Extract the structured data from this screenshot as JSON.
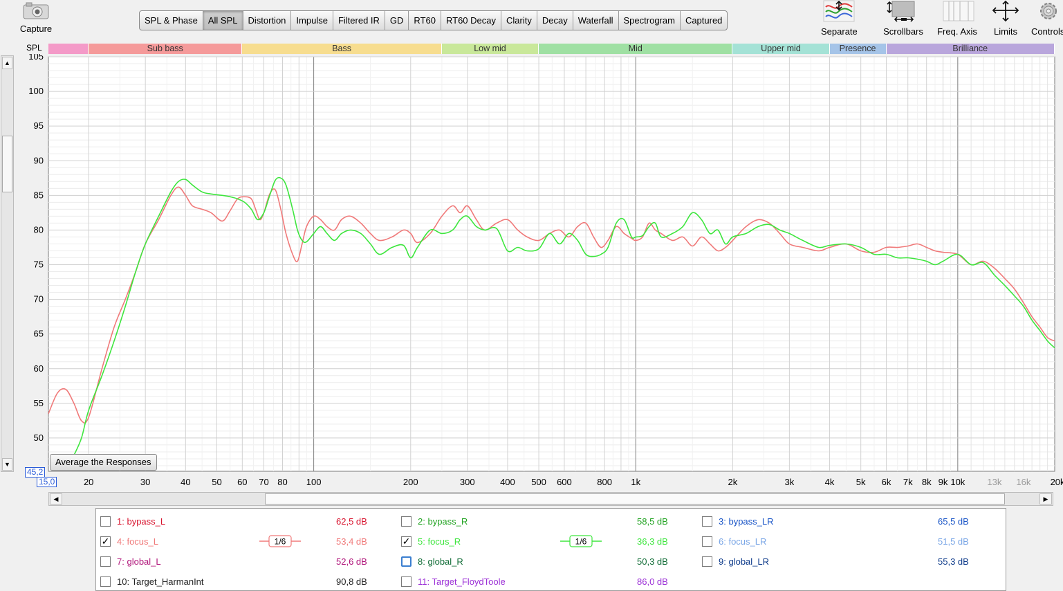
{
  "toolbar": {
    "capture_label": "Capture",
    "tabs": [
      {
        "label": "SPL & Phase",
        "active": false
      },
      {
        "label": "All SPL",
        "active": true
      },
      {
        "label": "Distortion",
        "active": false
      },
      {
        "label": "Impulse",
        "active": false
      },
      {
        "label": "Filtered IR",
        "active": false
      },
      {
        "label": "GD",
        "active": false
      },
      {
        "label": "RT60",
        "active": false
      },
      {
        "label": "RT60 Decay",
        "active": false
      },
      {
        "label": "Clarity",
        "active": false
      },
      {
        "label": "Decay",
        "active": false
      },
      {
        "label": "Waterfall",
        "active": false
      },
      {
        "label": "Spectrogram",
        "active": false
      },
      {
        "label": "Captured",
        "active": false
      }
    ],
    "right_tools": {
      "separate": "Separate",
      "scrollbars": "Scrollbars",
      "freq_axis": "Freq. Axis",
      "limits": "Limits",
      "controls": "Controls"
    }
  },
  "bands": [
    {
      "name": "",
      "color": "#f49ac8"
    },
    {
      "name": "Sub bass",
      "color": "#f59a9a"
    },
    {
      "name": "Bass",
      "color": "#f7dd8f"
    },
    {
      "name": "Low mid",
      "color": "#c9e89a"
    },
    {
      "name": "Mid",
      "color": "#9fe0a3"
    },
    {
      "name": "Upper mid",
      "color": "#a4e2d6"
    },
    {
      "name": "Presence",
      "color": "#a5c4e8"
    },
    {
      "name": "Brilliance",
      "color": "#b9a6dc"
    }
  ],
  "chart_data": {
    "type": "line",
    "ylabel": "SPL",
    "ylim": [
      45.2,
      105
    ],
    "y_ticks": [
      "105",
      "100",
      "95",
      "90",
      "85",
      "80",
      "75",
      "70",
      "65",
      "60",
      "55",
      "50"
    ],
    "xlim": [
      15,
      20000
    ],
    "x_scale": "log",
    "x_ticks": [
      "20",
      "30",
      "40",
      "50",
      "60",
      "70",
      "80",
      "100",
      "200",
      "300",
      "400",
      "500",
      "600",
      "800",
      "1k",
      "2k",
      "3k",
      "4k",
      "5k",
      "6k",
      "7k",
      "8k",
      "9k",
      "10k",
      "13k",
      "16k",
      "20kHz"
    ],
    "x_min_label": "15,0",
    "y_min_label": "45,2",
    "grid": true,
    "series": [
      {
        "name": "4: focus_L",
        "color": "#f07a7a",
        "x": [
          15,
          16,
          17,
          18,
          19,
          20,
          22,
          24,
          26,
          28,
          30,
          33,
          36,
          38,
          40,
          42,
          45,
          48,
          52,
          55,
          58,
          61,
          64,
          66,
          68,
          70,
          73,
          76,
          79,
          82,
          86,
          89,
          92,
          95,
          100,
          105,
          110,
          116,
          122,
          130,
          140,
          150,
          160,
          175,
          190,
          200,
          210,
          230,
          250,
          270,
          285,
          300,
          320,
          340,
          370,
          400,
          430,
          460,
          500,
          540,
          580,
          620,
          660,
          700,
          740,
          780,
          820,
          870,
          920,
          970,
          1000,
          1050,
          1100,
          1150,
          1200,
          1300,
          1400,
          1500,
          1600,
          1700,
          1800,
          1900,
          2000,
          2200,
          2400,
          2600,
          2800,
          3000,
          3300,
          3700,
          4000,
          4500,
          5000,
          5500,
          6000,
          6500,
          7000,
          7500,
          8000,
          8500,
          9000,
          10000,
          11000,
          12000,
          13000,
          14000,
          15000,
          16000,
          17000,
          18000,
          19000,
          20000
        ],
        "y": [
          53.5,
          56.5,
          57,
          55,
          52.5,
          53,
          60,
          66,
          70,
          74,
          78,
          81.5,
          85,
          86.2,
          85,
          83.5,
          83,
          82.5,
          81.3,
          82.8,
          84.5,
          84.8,
          84.5,
          83,
          81.5,
          82.5,
          85.2,
          85.8,
          83,
          79.5,
          76.5,
          75.5,
          78,
          80.5,
          82,
          81.5,
          80.5,
          80,
          81.5,
          82,
          81,
          79.5,
          78.5,
          79,
          80,
          79.5,
          78.2,
          79.5,
          82,
          83.5,
          82.5,
          83.5,
          81.5,
          80,
          81,
          81.5,
          80,
          79,
          78.5,
          79.5,
          80,
          79,
          80.5,
          81,
          79,
          77.5,
          78.5,
          80.5,
          79.5,
          78.8,
          78.5,
          79,
          81,
          80,
          79.5,
          78.5,
          79,
          77.7,
          79,
          78,
          77,
          77.5,
          78.5,
          80.5,
          81.5,
          81,
          79.5,
          78,
          77.5,
          77,
          77.5,
          78,
          77,
          76.8,
          77.5,
          77.5,
          77.7,
          78,
          77.5,
          77,
          76.8,
          76.5,
          75,
          75.5,
          74.5,
          73,
          71.5,
          69.5,
          67.5,
          66,
          64.5,
          64
        ]
      },
      {
        "name": "5: focus_R",
        "color": "#3ee63e",
        "x": [
          18,
          19,
          20,
          22,
          24,
          26,
          28,
          30,
          33,
          36,
          38,
          40,
          42,
          45,
          48,
          52,
          55,
          58,
          61,
          64,
          67,
          70,
          73,
          76,
          79,
          82,
          86,
          89,
          92,
          95,
          100,
          105,
          110,
          116,
          122,
          130,
          140,
          150,
          160,
          175,
          190,
          200,
          210,
          230,
          250,
          270,
          285,
          300,
          320,
          340,
          370,
          400,
          430,
          460,
          500,
          540,
          580,
          620,
          660,
          700,
          740,
          780,
          820,
          870,
          920,
          970,
          1000,
          1050,
          1100,
          1150,
          1200,
          1300,
          1400,
          1500,
          1600,
          1700,
          1800,
          1900,
          2000,
          2200,
          2400,
          2600,
          2800,
          3000,
          3300,
          3700,
          4000,
          4500,
          5000,
          5500,
          6000,
          6500,
          7000,
          7500,
          8000,
          8500,
          9000,
          10000,
          11000,
          12000,
          13000,
          14000,
          15000,
          16000,
          17000,
          18000,
          19000,
          20000
        ],
        "y": [
          47.5,
          50,
          54,
          59,
          64,
          69,
          74,
          78,
          82,
          85.5,
          87,
          87.3,
          86.5,
          85.5,
          85.2,
          85,
          84.8,
          84.5,
          84,
          83,
          81.5,
          82.5,
          85,
          87.2,
          87.5,
          86.5,
          83,
          80,
          78.5,
          78.3,
          79.5,
          80.5,
          79.5,
          78.5,
          79.5,
          80,
          79.5,
          78,
          76.5,
          77.5,
          77.8,
          76,
          77.5,
          80,
          79.5,
          80,
          81.5,
          82,
          80.5,
          80,
          80.2,
          77,
          77.5,
          77,
          77.3,
          79.5,
          78,
          79.5,
          78.5,
          76.5,
          76.2,
          76.5,
          77.5,
          81,
          81.5,
          79,
          79,
          79.2,
          80.5,
          81,
          79,
          79.5,
          80.5,
          82.5,
          81.5,
          79.5,
          80,
          78,
          79,
          79.5,
          80.5,
          80.8,
          80,
          79.5,
          78.5,
          77.5,
          77.8,
          78,
          77.5,
          76.5,
          76.5,
          76,
          76,
          75.8,
          75.5,
          75,
          75.5,
          76.5,
          75,
          75.3,
          73.5,
          72,
          70.5,
          69,
          67,
          65.5,
          64,
          63
        ]
      }
    ]
  },
  "avg_button": "Average the Responses",
  "legend": [
    {
      "num": "1:",
      "name": "bypass_L",
      "value": "62,5 dB",
      "checked": false,
      "color": "#d8132e"
    },
    {
      "num": "2:",
      "name": "bypass_R",
      "value": "58,5 dB",
      "checked": false,
      "color": "#22a322"
    },
    {
      "num": "3:",
      "name": "bypass_LR",
      "value": "65,5 dB",
      "checked": false,
      "color": "#1a55c7"
    },
    {
      "num": "4:",
      "name": "focus_L",
      "value": "53,4 dB",
      "checked": true,
      "color": "#f07a7a",
      "smoothing": "1/6"
    },
    {
      "num": "5:",
      "name": "focus_R",
      "value": "36,3 dB",
      "checked": true,
      "color": "#3ee63e",
      "smoothing": "1/6"
    },
    {
      "num": "6:",
      "name": "focus_LR",
      "value": "51,5 dB",
      "checked": false,
      "color": "#7aa6e6"
    },
    {
      "num": "7:",
      "name": "global_L",
      "value": "52,6 dB",
      "checked": false,
      "color": "#b0147a"
    },
    {
      "num": "8:",
      "name": "global_R",
      "value": "50,3 dB",
      "checked": false,
      "color": "#0f6b35"
    },
    {
      "num": "9:",
      "name": "global_LR",
      "value": "55,3 dB",
      "checked": false,
      "color": "#0d3a8a"
    },
    {
      "num": "10:",
      "name": "Target_HarmanInt",
      "value": "90,8 dB",
      "checked": false,
      "color": "#222222"
    },
    {
      "num": "11:",
      "name": "Target_FloydToole",
      "value": "86,0 dB",
      "checked": false,
      "color": "#9b2fd6"
    }
  ]
}
